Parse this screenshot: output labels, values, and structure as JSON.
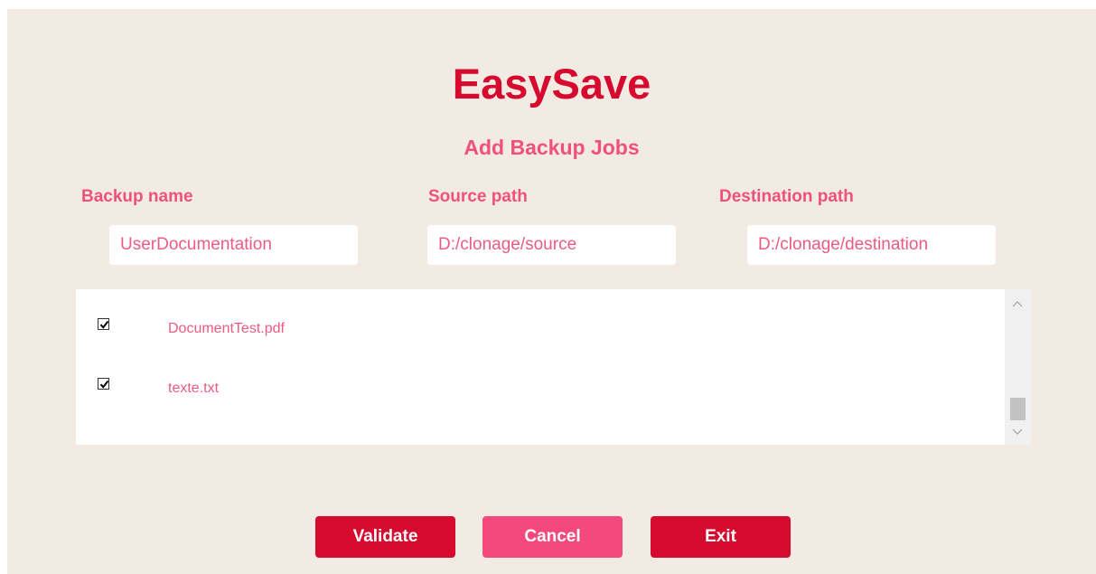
{
  "app": {
    "title": "EasySave",
    "page_title": "Add Backup Jobs"
  },
  "form": {
    "backup_name": {
      "label": "Backup name",
      "value": "UserDocumentation"
    },
    "source_path": {
      "label": "Source path",
      "value": "D:/clonage/source"
    },
    "destination_path": {
      "label": "Destination path",
      "value": "D:/clonage/destination"
    }
  },
  "files": [
    {
      "name": "DocumentTest.pdf",
      "checked": true
    },
    {
      "name": "texte.txt",
      "checked": true
    }
  ],
  "buttons": {
    "validate": "Validate",
    "cancel": "Cancel",
    "exit": "Exit"
  },
  "colors": {
    "title_red": "#d50a2e",
    "accent_pink": "#f0507d",
    "background": "#f2ebe4",
    "button_red": "#d50a2e",
    "button_pink": "#f5497d"
  },
  "icons": {
    "checkbox": "checkmark-icon",
    "scroll_up": "chevron-up-icon",
    "scroll_down": "chevron-down-icon"
  }
}
